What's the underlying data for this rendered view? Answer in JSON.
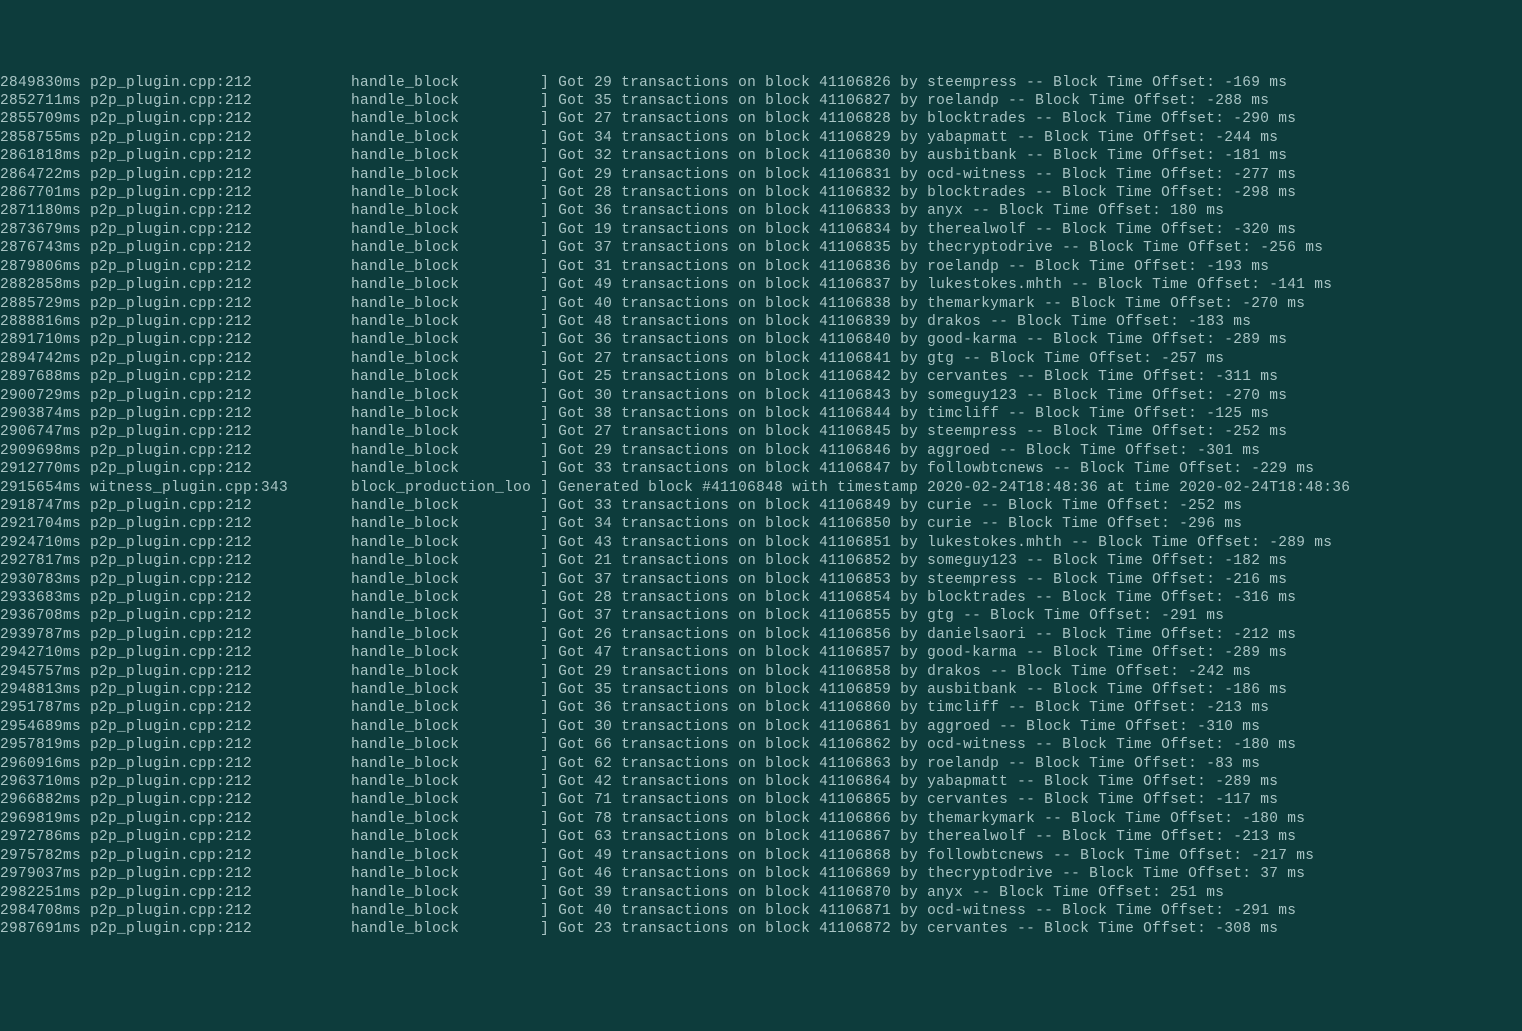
{
  "log": {
    "source_p2p": "p2p_plugin.cpp:212",
    "source_witness": "witness_plugin.cpp:343",
    "fn_handle": "handle_block",
    "fn_produce": "block_production_loo",
    "generated_block_num": "41106848",
    "generated_timestamp": "2020-02-24T18:48:36",
    "generated_at_time": "2020-02-24T18:48:36",
    "lines": [
      {
        "type": "handle",
        "ts": "2849830ms",
        "tx": "29",
        "block": "41106826",
        "by": "steempress",
        "offset": "-169"
      },
      {
        "type": "handle",
        "ts": "2852711ms",
        "tx": "35",
        "block": "41106827",
        "by": "roelandp",
        "offset": "-288"
      },
      {
        "type": "handle",
        "ts": "2855709ms",
        "tx": "27",
        "block": "41106828",
        "by": "blocktrades",
        "offset": "-290"
      },
      {
        "type": "handle",
        "ts": "2858755ms",
        "tx": "34",
        "block": "41106829",
        "by": "yabapmatt",
        "offset": "-244"
      },
      {
        "type": "handle",
        "ts": "2861818ms",
        "tx": "32",
        "block": "41106830",
        "by": "ausbitbank",
        "offset": "-181"
      },
      {
        "type": "handle",
        "ts": "2864722ms",
        "tx": "29",
        "block": "41106831",
        "by": "ocd-witness",
        "offset": "-277"
      },
      {
        "type": "handle",
        "ts": "2867701ms",
        "tx": "28",
        "block": "41106832",
        "by": "blocktrades",
        "offset": "-298"
      },
      {
        "type": "handle",
        "ts": "2871180ms",
        "tx": "36",
        "block": "41106833",
        "by": "anyx",
        "offset": "180"
      },
      {
        "type": "handle",
        "ts": "2873679ms",
        "tx": "19",
        "block": "41106834",
        "by": "therealwolf",
        "offset": "-320"
      },
      {
        "type": "handle",
        "ts": "2876743ms",
        "tx": "37",
        "block": "41106835",
        "by": "thecryptodrive",
        "offset": "-256"
      },
      {
        "type": "handle",
        "ts": "2879806ms",
        "tx": "31",
        "block": "41106836",
        "by": "roelandp",
        "offset": "-193"
      },
      {
        "type": "handle",
        "ts": "2882858ms",
        "tx": "49",
        "block": "41106837",
        "by": "lukestokes.mhth",
        "offset": "-141"
      },
      {
        "type": "handle",
        "ts": "2885729ms",
        "tx": "40",
        "block": "41106838",
        "by": "themarkymark",
        "offset": "-270"
      },
      {
        "type": "handle",
        "ts": "2888816ms",
        "tx": "48",
        "block": "41106839",
        "by": "drakos",
        "offset": "-183"
      },
      {
        "type": "handle",
        "ts": "2891710ms",
        "tx": "36",
        "block": "41106840",
        "by": "good-karma",
        "offset": "-289"
      },
      {
        "type": "handle",
        "ts": "2894742ms",
        "tx": "27",
        "block": "41106841",
        "by": "gtg",
        "offset": "-257"
      },
      {
        "type": "handle",
        "ts": "2897688ms",
        "tx": "25",
        "block": "41106842",
        "by": "cervantes",
        "offset": "-311"
      },
      {
        "type": "handle",
        "ts": "2900729ms",
        "tx": "30",
        "block": "41106843",
        "by": "someguy123",
        "offset": "-270"
      },
      {
        "type": "handle",
        "ts": "2903874ms",
        "tx": "38",
        "block": "41106844",
        "by": "timcliff",
        "offset": "-125"
      },
      {
        "type": "handle",
        "ts": "2906747ms",
        "tx": "27",
        "block": "41106845",
        "by": "steempress",
        "offset": "-252"
      },
      {
        "type": "handle",
        "ts": "2909698ms",
        "tx": "29",
        "block": "41106846",
        "by": "aggroed",
        "offset": "-301"
      },
      {
        "type": "handle",
        "ts": "2912770ms",
        "tx": "33",
        "block": "41106847",
        "by": "followbtcnews",
        "offset": "-229"
      },
      {
        "type": "produce",
        "ts": "2915654ms"
      },
      {
        "type": "handle",
        "ts": "2918747ms",
        "tx": "33",
        "block": "41106849",
        "by": "curie",
        "offset": "-252"
      },
      {
        "type": "handle",
        "ts": "2921704ms",
        "tx": "34",
        "block": "41106850",
        "by": "curie",
        "offset": "-296"
      },
      {
        "type": "handle",
        "ts": "2924710ms",
        "tx": "43",
        "block": "41106851",
        "by": "lukestokes.mhth",
        "offset": "-289"
      },
      {
        "type": "handle",
        "ts": "2927817ms",
        "tx": "21",
        "block": "41106852",
        "by": "someguy123",
        "offset": "-182"
      },
      {
        "type": "handle",
        "ts": "2930783ms",
        "tx": "37",
        "block": "41106853",
        "by": "steempress",
        "offset": "-216"
      },
      {
        "type": "handle",
        "ts": "2933683ms",
        "tx": "28",
        "block": "41106854",
        "by": "blocktrades",
        "offset": "-316"
      },
      {
        "type": "handle",
        "ts": "2936708ms",
        "tx": "37",
        "block": "41106855",
        "by": "gtg",
        "offset": "-291"
      },
      {
        "type": "handle",
        "ts": "2939787ms",
        "tx": "26",
        "block": "41106856",
        "by": "danielsaori",
        "offset": "-212"
      },
      {
        "type": "handle",
        "ts": "2942710ms",
        "tx": "47",
        "block": "41106857",
        "by": "good-karma",
        "offset": "-289"
      },
      {
        "type": "handle",
        "ts": "2945757ms",
        "tx": "29",
        "block": "41106858",
        "by": "drakos",
        "offset": "-242"
      },
      {
        "type": "handle",
        "ts": "2948813ms",
        "tx": "35",
        "block": "41106859",
        "by": "ausbitbank",
        "offset": "-186"
      },
      {
        "type": "handle",
        "ts": "2951787ms",
        "tx": "36",
        "block": "41106860",
        "by": "timcliff",
        "offset": "-213"
      },
      {
        "type": "handle",
        "ts": "2954689ms",
        "tx": "30",
        "block": "41106861",
        "by": "aggroed",
        "offset": "-310"
      },
      {
        "type": "handle",
        "ts": "2957819ms",
        "tx": "66",
        "block": "41106862",
        "by": "ocd-witness",
        "offset": "-180"
      },
      {
        "type": "handle",
        "ts": "2960916ms",
        "tx": "62",
        "block": "41106863",
        "by": "roelandp",
        "offset": "-83"
      },
      {
        "type": "handle",
        "ts": "2963710ms",
        "tx": "42",
        "block": "41106864",
        "by": "yabapmatt",
        "offset": "-289"
      },
      {
        "type": "handle",
        "ts": "2966882ms",
        "tx": "71",
        "block": "41106865",
        "by": "cervantes",
        "offset": "-117"
      },
      {
        "type": "handle",
        "ts": "2969819ms",
        "tx": "78",
        "block": "41106866",
        "by": "themarkymark",
        "offset": "-180"
      },
      {
        "type": "handle",
        "ts": "2972786ms",
        "tx": "63",
        "block": "41106867",
        "by": "therealwolf",
        "offset": "-213"
      },
      {
        "type": "handle",
        "ts": "2975782ms",
        "tx": "49",
        "block": "41106868",
        "by": "followbtcnews",
        "offset": "-217"
      },
      {
        "type": "handle",
        "ts": "2979037ms",
        "tx": "46",
        "block": "41106869",
        "by": "thecryptodrive",
        "offset": "37"
      },
      {
        "type": "handle",
        "ts": "2982251ms",
        "tx": "39",
        "block": "41106870",
        "by": "anyx",
        "offset": "251"
      },
      {
        "type": "handle",
        "ts": "2984708ms",
        "tx": "40",
        "block": "41106871",
        "by": "ocd-witness",
        "offset": "-291"
      },
      {
        "type": "handle",
        "ts": "2987691ms",
        "tx": "23",
        "block": "41106872",
        "by": "cervantes",
        "offset": "-308"
      }
    ]
  }
}
